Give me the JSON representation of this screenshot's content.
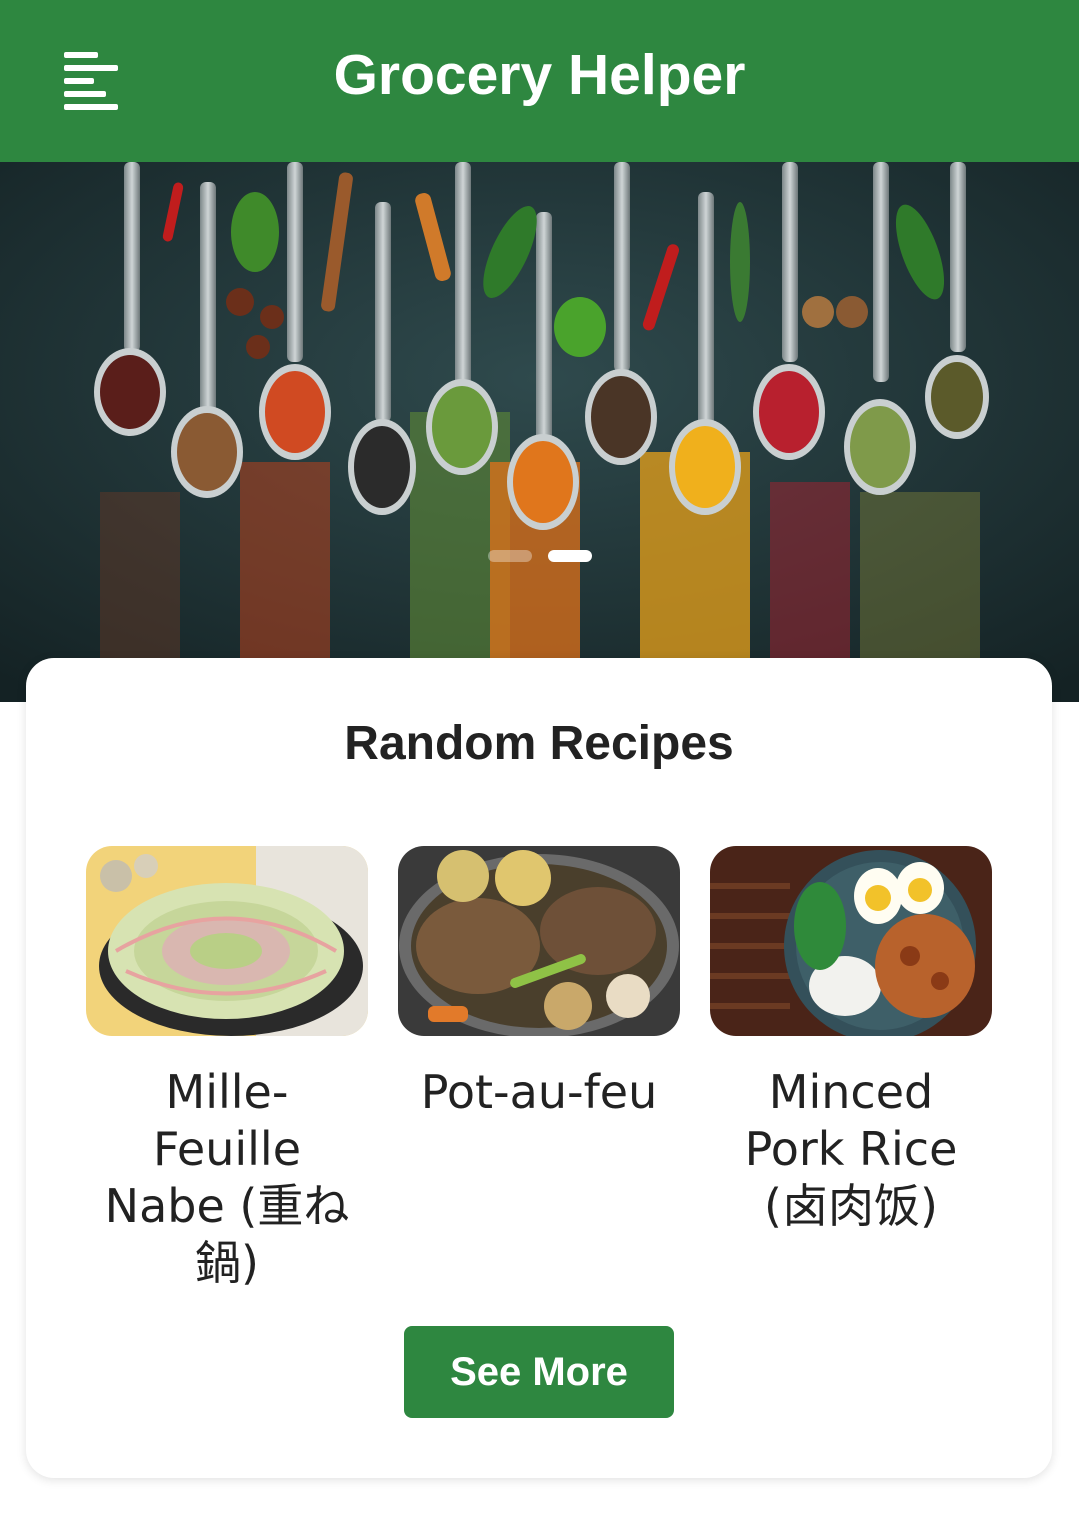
{
  "app_bar": {
    "title": "Grocery Helper",
    "menu_icon": "menu-icon",
    "color": "#2e8740"
  },
  "hero": {
    "image": "spices-on-spoons-photo",
    "carousel": {
      "slide_count": 2,
      "active_index": 1
    }
  },
  "random_recipes": {
    "title": "Random Recipes",
    "items": [
      {
        "name": "Mille-Feuille Nabe (重ね鍋)",
        "image": "mille-feuille-nabe-photo"
      },
      {
        "name": "Pot-au-feu",
        "image": "pot-au-feu-photo"
      },
      {
        "name": "Minced Pork Rice (卤肉饭)",
        "image": "minced-pork-rice-photo"
      }
    ],
    "see_more_label": "See More"
  }
}
